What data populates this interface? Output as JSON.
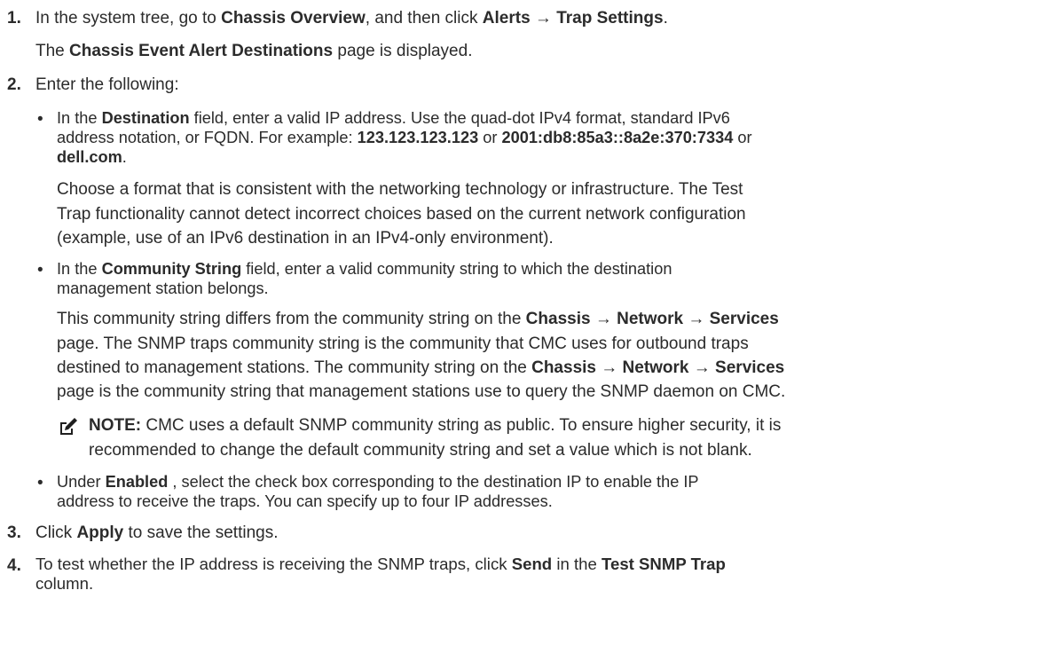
{
  "steps": [
    {
      "number": "1.",
      "line1": {
        "t1": "In the system tree, go to ",
        "b1": "Chassis Overview",
        "t2": ", and then click ",
        "b2": "Alerts → Trap Settings",
        "t3": "."
      },
      "line2": {
        "t1": "The ",
        "b1": "Chassis Event Alert Destinations",
        "t2": " page is displayed."
      }
    },
    {
      "number": "2.",
      "text": "Enter the following:",
      "bullets": [
        {
          "line1": {
            "t1": "In the ",
            "b1": "Destination",
            "t2": " field, enter a valid IP address. Use the quad-dot IPv4 format, standard IPv6"
          },
          "line2": {
            "t1": "address notation, or FQDN. For example: ",
            "b1": "123.123.123.123",
            "t2": " or ",
            "b2": "2001:db8:85a3::8a2e:370:7334",
            "t3": " or"
          },
          "line3": {
            "b1": "dell.com",
            "t1": "."
          },
          "para": [
            "Choose a format that is consistent with the networking technology or infrastructure. The Test",
            "Trap functionality cannot detect incorrect choices based on the current network configuration",
            "(example, use of an IPv6 destination in an IPv4-only environment)."
          ]
        },
        {
          "line1": {
            "t1": "In the ",
            "b1": "Community String",
            "t2": " field, enter a valid community string to which the destination"
          },
          "line2": {
            "t1": "management station belongs."
          },
          "para": {
            "l1": {
              "t1": "This community string differs from the community string on the ",
              "b1": "Chassis → Network → Services"
            },
            "l2": "page. The SNMP traps community string is the community that CMC uses for outbound traps",
            "l3": {
              "t1": "destined to management stations. The community string on the ",
              "b1": "Chassis → Network → Services"
            },
            "l4": "page is the community string that management stations use to query the SNMP daemon on CMC."
          },
          "note": {
            "label": "NOTE:",
            "l1": " CMC uses a default SNMP community string as public. To ensure higher security, it is",
            "l2": "recommended to change the default community string and set a value which is not blank."
          }
        },
        {
          "line1": {
            "t1": "Under ",
            "b1": "Enabled",
            "t2": " , select the check box corresponding to the destination IP to enable the IP"
          },
          "line2": {
            "t1": "address to receive the traps. You can specify up to four IP addresses."
          }
        }
      ]
    },
    {
      "number": "3.",
      "line1": {
        "t1": "Click ",
        "b1": "Apply",
        "t2": " to save the settings."
      }
    },
    {
      "number": "4.",
      "line1": {
        "t1": "To test whether the IP address is receiving the SNMP traps, click ",
        "b1": "Send",
        "t2": " in the ",
        "b2": "Test SNMP Trap"
      },
      "line2": {
        "t1": "column."
      }
    }
  ],
  "bullet_char": "•",
  "note_icon": "pencil-note-icon"
}
